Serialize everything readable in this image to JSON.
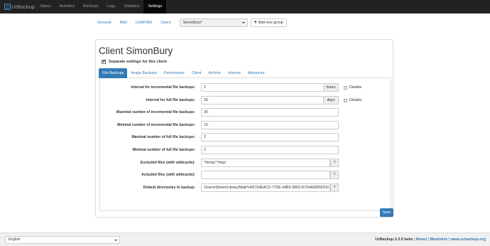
{
  "nav": {
    "brand": "UrBackup",
    "items": [
      "Status",
      "Activities",
      "Backups",
      "Logs",
      "Statistics",
      "Settings"
    ],
    "active": "Settings"
  },
  "groups": {
    "tabs": [
      "General",
      "Mail",
      "LDAP/AD",
      "Users"
    ],
    "selected_client": "SimonBury*",
    "add_group_label": "Add new group"
  },
  "client": {
    "title": "Client SimonBury",
    "separate_label": "Separate settings for this client",
    "separate_checked": true,
    "tabs": [
      "File Backups",
      "Image Backups",
      "Permissions",
      "Client",
      "Archive",
      "Internet",
      "Advanced"
    ],
    "active_tab": "File Backups"
  },
  "settings": {
    "incr_interval": {
      "label": "Interval for incremental file backups:",
      "value": "2",
      "unit": "hours",
      "disable": "Disable"
    },
    "full_interval": {
      "label": "Interval for full file backups:",
      "value": "30",
      "unit": "days",
      "disable": "Disable"
    },
    "max_incr": {
      "label": "Maximal number of incremental file backups:",
      "value": "30"
    },
    "min_incr": {
      "label": "Minimal number of incremental file backups:",
      "value": "10"
    },
    "max_full": {
      "label": "Maximal number of full file backups:",
      "value": "2"
    },
    "min_full": {
      "label": "Minimal number of full file backups:",
      "value": "2"
    },
    "excluded": {
      "label": "Excluded files (with wildcards):",
      "value": "*/temp/;*/tmp/",
      "help": "?"
    },
    "included": {
      "label": "Included files (with wildcards):",
      "value": "",
      "help": "?"
    },
    "default_dirs": {
      "label": "Default directories to backup:",
      "value": "/Users/Simon/Library/Mail/V4/F154EAC0-77DE-44B5-9803-D704A5805DF6/",
      "help": "?"
    }
  },
  "save_label": "Save",
  "footer": {
    "language": "English",
    "version": "UrBackup 2.2.0 beta",
    "sep1": " | ",
    "about": "About",
    "sep2": " | ",
    "maximize": "Maximize",
    "sep3": " | ",
    "site": "www.urbackup.org"
  },
  "colors": {
    "accent": "#337ab7",
    "navbar": "#222222"
  }
}
